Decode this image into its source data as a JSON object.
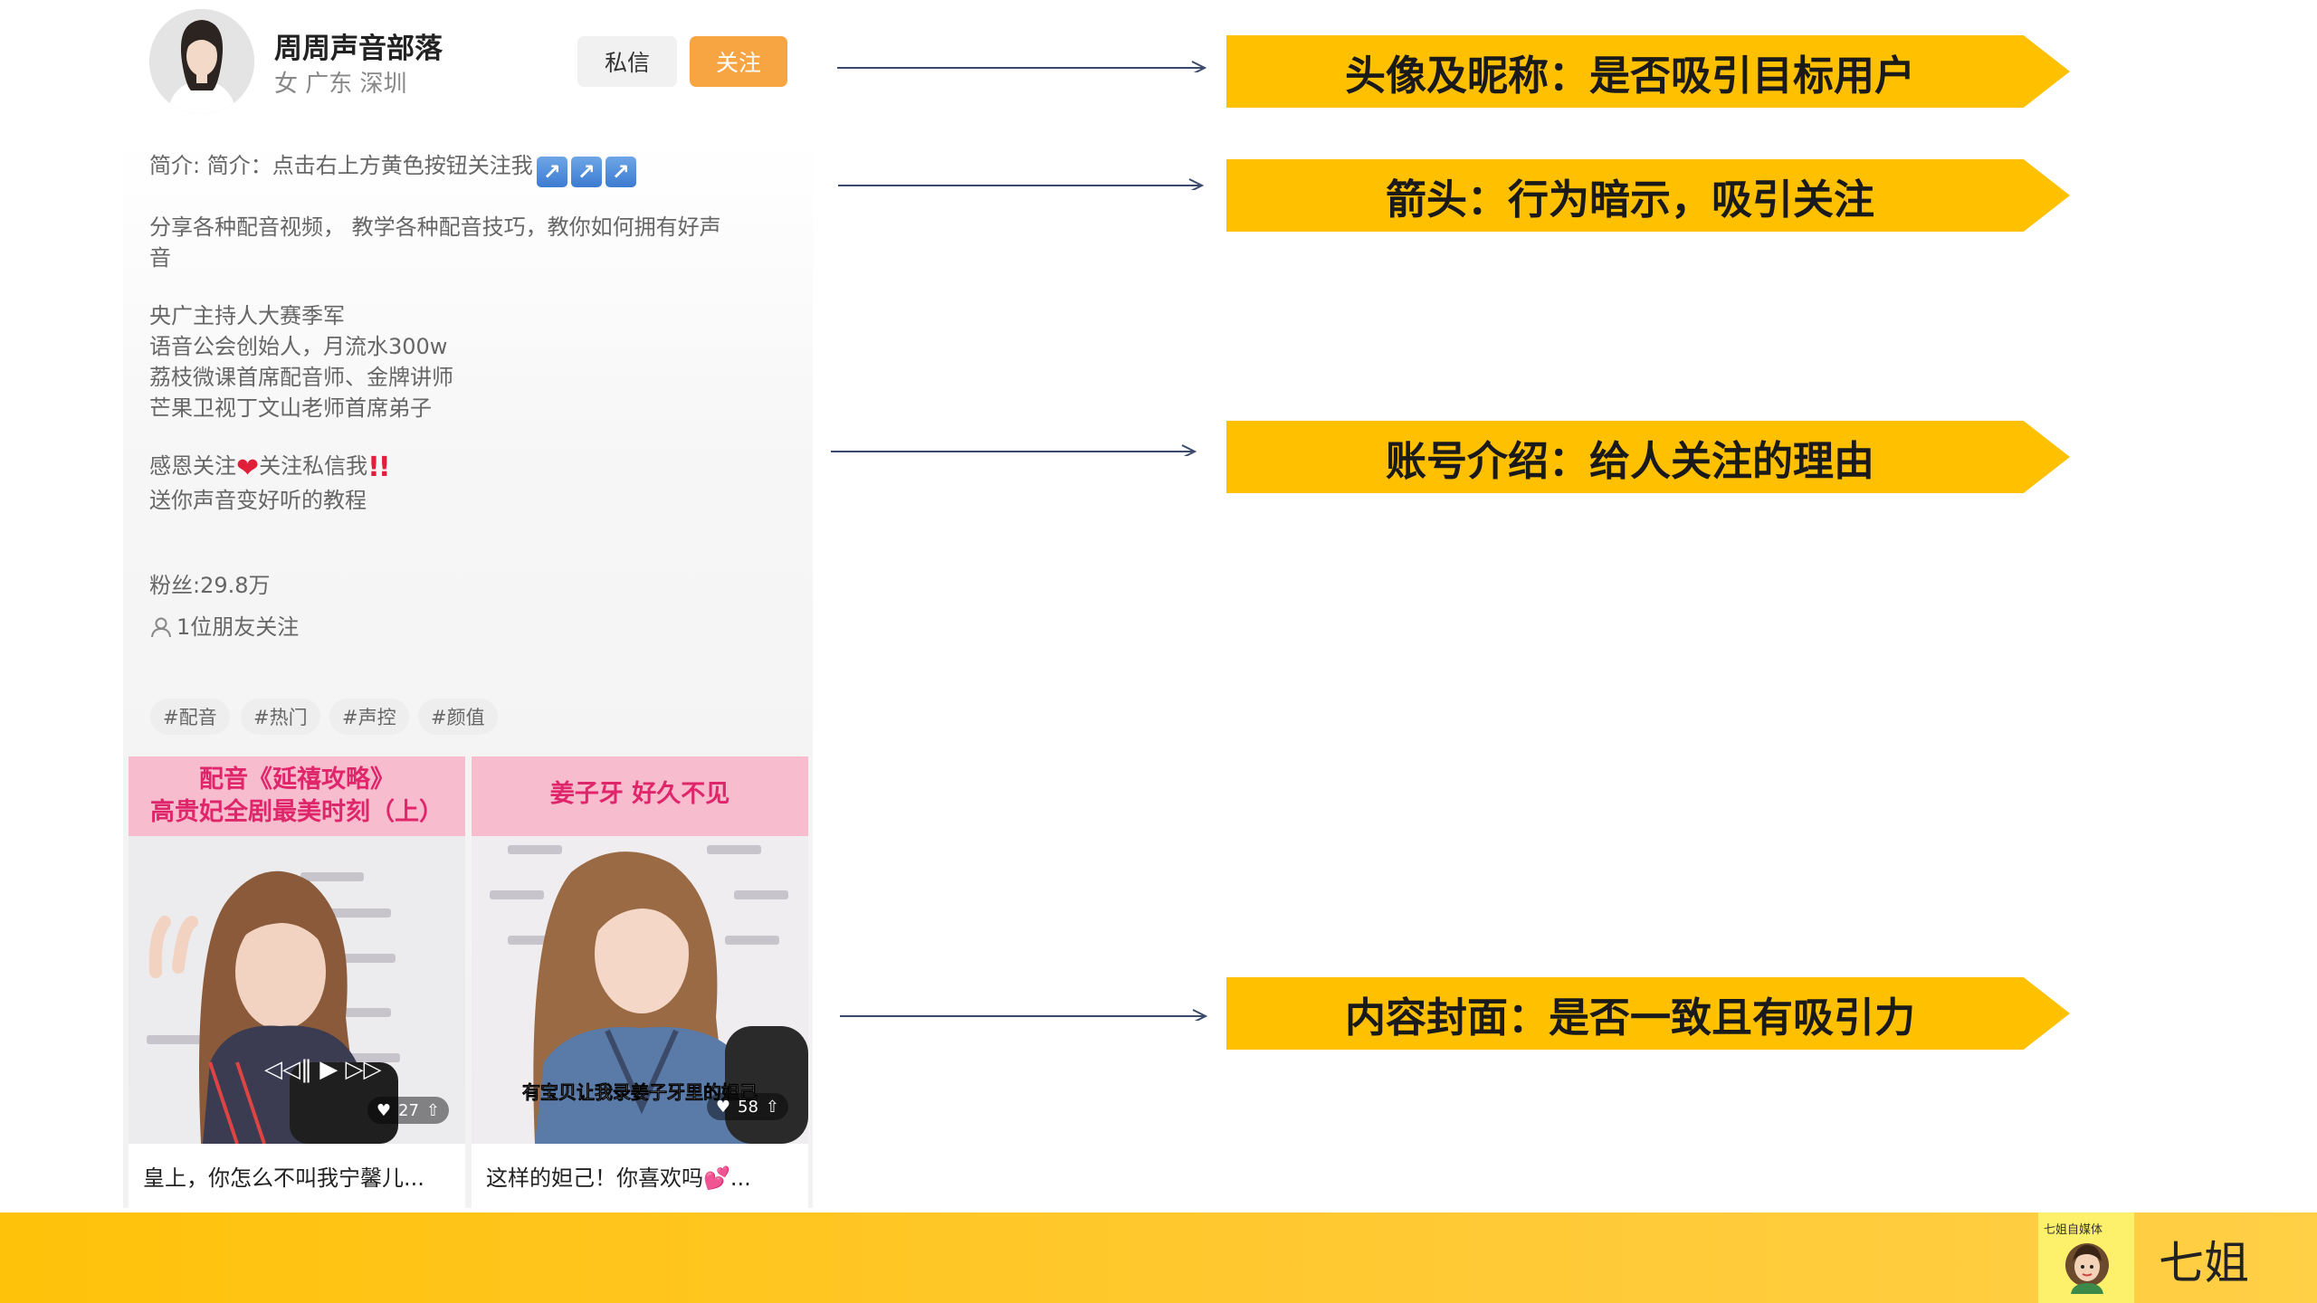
{
  "profile": {
    "name": "周周声音部落",
    "meta": "女 广东 深圳",
    "btn_message": "私信",
    "btn_follow": "关注",
    "bio_line1": "简介: 简介：点击右上方黄色按钮关注我",
    "bio_line2": "分享各种配音视频，  教学各种配音技巧，教你如何拥有好声",
    "bio_line3": "音",
    "bio_line4": "央广主持人大赛季军",
    "bio_line5": "语音公会创始人，月流水300w",
    "bio_line6": "荔枝微课首席配音师、金牌讲师",
    "bio_line7": "芒果卫视丁文山老师首席弟子",
    "bio_line8a": "感恩关注",
    "bio_line8b": "关注私信我",
    "bio_line9": "送你声音变好听的教程",
    "fans": "粉丝:29.8万",
    "friends": "1位朋友关注",
    "tags": [
      "#配音",
      "#热门",
      "#声控",
      "#颜值"
    ]
  },
  "videos": [
    {
      "banner_line1": "配音《延禧攻略》",
      "banner_line2": "高贵妃全剧最美时刻（上）",
      "likes": "27",
      "caption": "皇上，你怎么不叫我宁馨儿..."
    },
    {
      "banner_line1": "姜子牙 好久不见",
      "subtitle": "有宝贝让我录姜子牙里的妲己",
      "likes": "58",
      "caption": "这样的妲己！你喜欢吗",
      "caption_tail": "..."
    }
  ],
  "annotations": [
    "头像及昵称：是否吸引目标用户",
    "箭头：行为暗示，吸引关注",
    "账号介绍：给人关注的理由",
    "内容封面：是否一致且有吸引力"
  ],
  "footer": {
    "logo_text": "七姐自媒体",
    "brand": "七姐"
  },
  "colors": {
    "accent_yellow": "#ffc000",
    "follow_orange": "#f7a443",
    "cover_pink": "#f7bccd",
    "heart_red": "#e0203a"
  }
}
